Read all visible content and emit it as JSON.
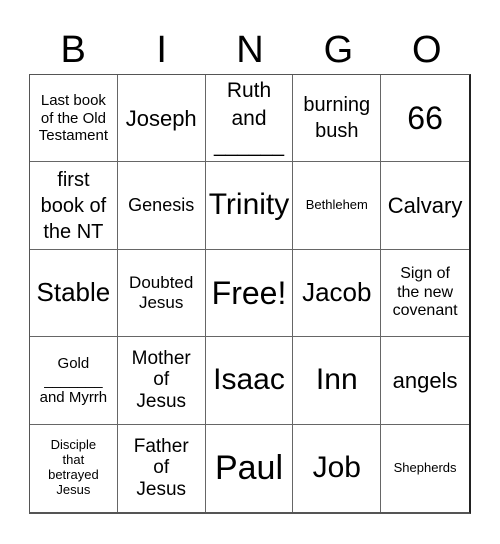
{
  "header": [
    "B",
    "I",
    "N",
    "G",
    "O"
  ],
  "cells": [
    "Last book\nof the Old\nTestament",
    "Joseph",
    "Ruth\nand\n______",
    "burning\nbush",
    "66",
    "first\nbook of\nthe NT",
    "Genesis",
    "Trinity",
    "Bethlehem",
    "Calvary",
    "Stable",
    "Doubted\nJesus",
    "Free!",
    "Jacob",
    "Sign of\nthe new\ncovenant",
    "Gold\n_______\nand Myrrh",
    "Mother\nof\nJesus",
    "Isaac",
    "Inn",
    "angels",
    "Disciple\nthat\nbetrayed\nJesus",
    "Father\nof\nJesus",
    "Paul",
    "Job",
    "Shepherds"
  ]
}
